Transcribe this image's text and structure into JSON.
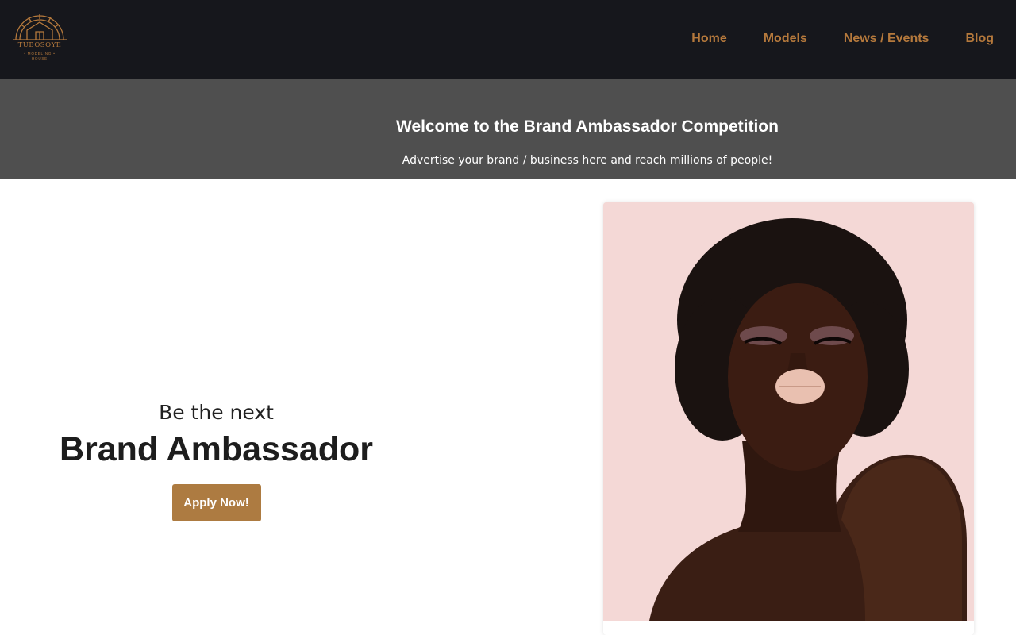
{
  "brand": {
    "name": "TUBOSOYE",
    "sub1": "• MODELING •",
    "sub2": "HOUSE",
    "accent": "#b5793c"
  },
  "nav": {
    "items": [
      {
        "label": "Home"
      },
      {
        "label": "Models"
      },
      {
        "label": "News / Events"
      },
      {
        "label": "Blog"
      }
    ]
  },
  "banner": {
    "title": "Welcome to the Brand Ambassador Competition",
    "subtitle": "Advertise your brand / business here and reach millions of people!",
    "background": "#4f4f4f"
  },
  "hero": {
    "tagline": "Be the next",
    "headline": "Brand Ambassador",
    "cta_label": "Apply Now!",
    "cta_color": "#ad7b41"
  },
  "photo": {
    "background": "#f4d8d6",
    "icon": "model-portrait-image"
  }
}
